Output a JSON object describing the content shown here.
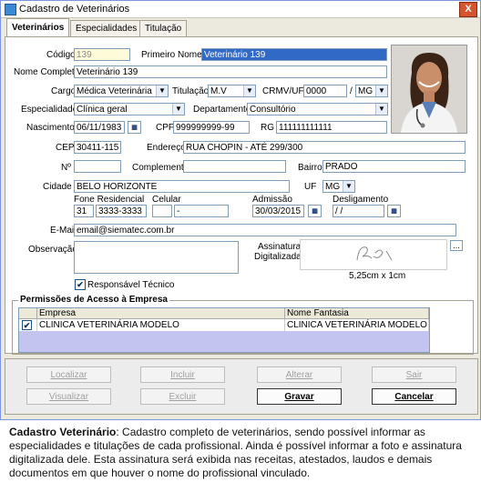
{
  "window": {
    "title": "Cadastro  de Veterinários",
    "close_label": "X"
  },
  "tabs": [
    {
      "label": "Veterinários"
    },
    {
      "label": "Especialidades"
    },
    {
      "label": "Titulação"
    }
  ],
  "form": {
    "codigo_label": "Código",
    "codigo_value": "139",
    "primeiro_nome_label": "Primeiro Nome",
    "primeiro_nome_value": "Veterinário 139",
    "nome_completo_label": "Nome Completo",
    "nome_completo_value": "Veterinário 139",
    "cargo_label": "Cargo",
    "cargo_value": "Médica Veterinária",
    "titulacao_label": "Titulação",
    "titulacao_value": "M.V",
    "crmv_label": "CRMV/UF",
    "crmv_value": "0000",
    "crmv_sep": "/",
    "crmv_uf_value": "MG",
    "especialidade_label": "Especialidade",
    "especialidade_value": "Clínica geral",
    "departamento_label": "Departamento",
    "departamento_value": "Consultório",
    "nascimento_label": "Nascimento",
    "nascimento_value": "06/11/1983",
    "cpf_label": "CPF",
    "cpf_value": "999999999-99",
    "rg_label": "RG",
    "rg_value": "111111111111",
    "cep_label": "CEP",
    "cep_value": "30411-115",
    "endereco_label": "Endereço",
    "endereco_value": "RUA CHOPIN - ATÉ 299/300",
    "numero_label": "Nº",
    "numero_value": "",
    "complemento_label": "Complemento",
    "complemento_value": "",
    "bairro_label": "Bairro",
    "bairro_value": "PRADO",
    "cidade_label": "Cidade",
    "cidade_value": "BELO HORIZONTE",
    "uf_label": "UF",
    "uf_value": "MG",
    "fone_res_label": "Fone Residencial",
    "fone_ddd_value": "31",
    "fone_value": "3333-3333",
    "celular_label": "Celular",
    "celular_ddd_value": "",
    "celular_value": "-",
    "admissao_label": "Admissão",
    "admissao_value": "30/03/2015",
    "desligamento_label": "Desligamento",
    "desligamento_value": "/ /",
    "email_label": "E-Mail",
    "email_value": "email@siematec.com.br",
    "observacao_label": "Observação",
    "observacao_value": "",
    "assinatura_label_1": "Assinatura",
    "assinatura_label_2": "Digitalizada",
    "assinatura_dim": "5,25cm x 1cm",
    "assinatura_btn": "...",
    "responsavel_label": "Responsável Técnico",
    "responsavel_checked": "✔"
  },
  "permissions": {
    "title": "Permissões de Acesso à Empresa",
    "columns": [
      "Empresa",
      "Nome Fantasia"
    ],
    "rows": [
      {
        "checked": "✔",
        "empresa": "CLINICA VETERINÁRIA MODELO",
        "fantasia": "CLINICA VETERINÁRIA MODELO"
      }
    ]
  },
  "buttons": {
    "localizar": "Localizar",
    "incluir": "Incluir",
    "alterar": "Alterar",
    "sair": "Sair",
    "visualizar": "Visualizar",
    "excluir": "Excluir",
    "gravar": "Gravar",
    "cancelar": "Cancelar"
  },
  "caption": {
    "bold": "Cadastro Veterinário",
    "text": ": Cadastro completo de veterinários, sendo possível informar as especialidades e titulações de cada profissional. Ainda é possível informar a foto e assinatura digitalizada dele. Esta assinatura será exibida nas receitas, atestados, laudos e demais documentos em que houver o nome do profissional vinculado."
  },
  "colors": {
    "title_accent": "#3169c6",
    "grid_bg": "#c4c4f0",
    "window_border": "#7a96df"
  }
}
